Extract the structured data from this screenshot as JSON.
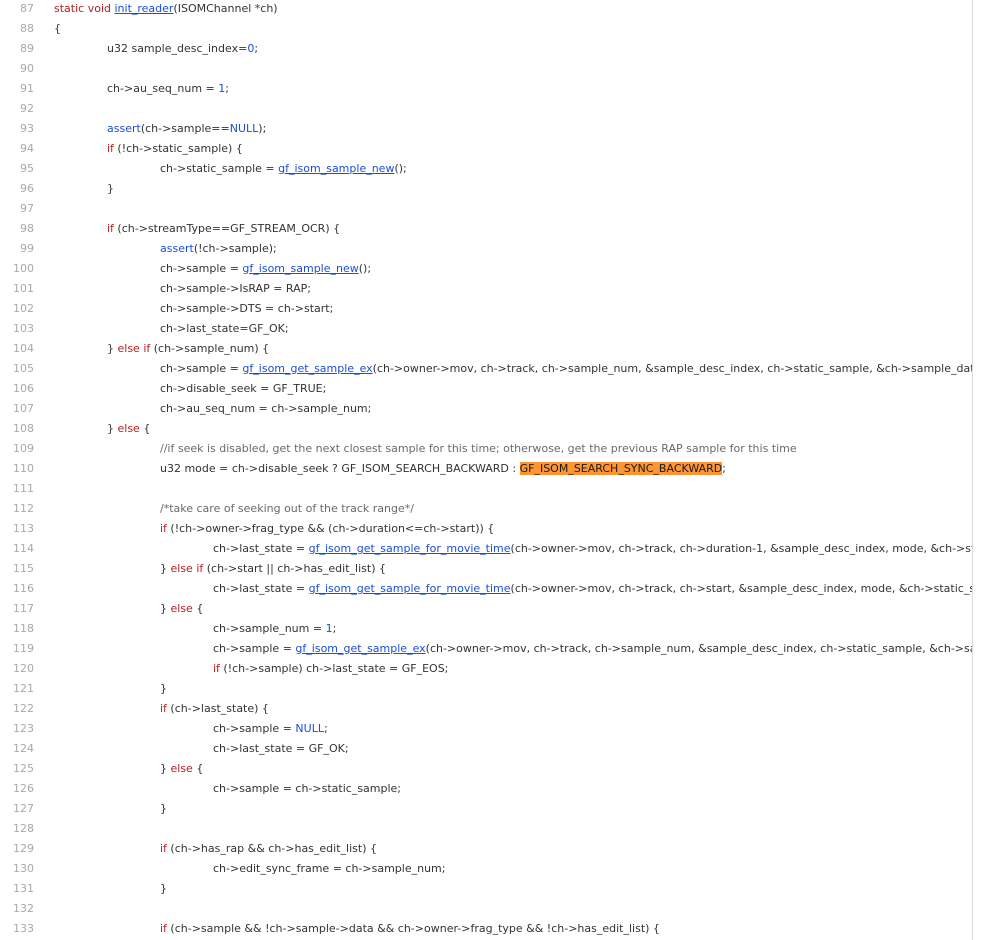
{
  "editor": {
    "lines": [
      {
        "n": "87",
        "indent": 0,
        "parts": [
          {
            "t": "static void ",
            "c": "kw"
          },
          {
            "t": "init_reader",
            "c": "fn"
          },
          {
            "t": "(ISOMChannel *ch)",
            "c": ""
          }
        ]
      },
      {
        "n": "88",
        "indent": 0,
        "parts": [
          {
            "t": "{",
            "c": ""
          }
        ]
      },
      {
        "n": "89",
        "indent": 1,
        "parts": [
          {
            "t": "u32 sample_desc_index=",
            "c": ""
          },
          {
            "t": "0",
            "c": "lit"
          },
          {
            "t": ";",
            "c": ""
          }
        ]
      },
      {
        "n": "90",
        "indent": 0,
        "parts": []
      },
      {
        "n": "91",
        "indent": 1,
        "parts": [
          {
            "t": "ch->au_seq_num = ",
            "c": ""
          },
          {
            "t": "1",
            "c": "lit"
          },
          {
            "t": ";",
            "c": ""
          }
        ]
      },
      {
        "n": "92",
        "indent": 0,
        "parts": []
      },
      {
        "n": "93",
        "indent": 1,
        "parts": [
          {
            "t": "assert",
            "c": "lit"
          },
          {
            "t": "(ch->sample==",
            "c": ""
          },
          {
            "t": "NULL",
            "c": "lit"
          },
          {
            "t": ");",
            "c": ""
          }
        ]
      },
      {
        "n": "94",
        "indent": 1,
        "parts": [
          {
            "t": "if",
            "c": "kw"
          },
          {
            "t": " (!ch->static_sample) {",
            "c": ""
          }
        ]
      },
      {
        "n": "95",
        "indent": 2,
        "parts": [
          {
            "t": "ch->static_sample = ",
            "c": ""
          },
          {
            "t": "gf_isom_sample_new",
            "c": "fn"
          },
          {
            "t": "();",
            "c": ""
          }
        ]
      },
      {
        "n": "96",
        "indent": 1,
        "parts": [
          {
            "t": "}",
            "c": ""
          }
        ]
      },
      {
        "n": "97",
        "indent": 0,
        "parts": []
      },
      {
        "n": "98",
        "indent": 1,
        "parts": [
          {
            "t": "if",
            "c": "kw"
          },
          {
            "t": " (ch->streamType==GF_STREAM_OCR) {",
            "c": ""
          }
        ]
      },
      {
        "n": "99",
        "indent": 2,
        "parts": [
          {
            "t": "assert",
            "c": "lit"
          },
          {
            "t": "(!ch->sample);",
            "c": ""
          }
        ]
      },
      {
        "n": "100",
        "indent": 2,
        "parts": [
          {
            "t": "ch->sample = ",
            "c": ""
          },
          {
            "t": "gf_isom_sample_new",
            "c": "fn"
          },
          {
            "t": "();",
            "c": ""
          }
        ]
      },
      {
        "n": "101",
        "indent": 2,
        "parts": [
          {
            "t": "ch->sample->IsRAP = RAP;",
            "c": ""
          }
        ]
      },
      {
        "n": "102",
        "indent": 2,
        "parts": [
          {
            "t": "ch->sample->DTS = ch->start;",
            "c": ""
          }
        ]
      },
      {
        "n": "103",
        "indent": 2,
        "parts": [
          {
            "t": "ch->last_state=GF_OK;",
            "c": ""
          }
        ]
      },
      {
        "n": "104",
        "indent": 1,
        "parts": [
          {
            "t": "} ",
            "c": ""
          },
          {
            "t": "else if",
            "c": "kw"
          },
          {
            "t": " (ch->sample_num) {",
            "c": ""
          }
        ]
      },
      {
        "n": "105",
        "indent": 2,
        "parts": [
          {
            "t": "ch->sample = ",
            "c": ""
          },
          {
            "t": "gf_isom_get_sample_ex",
            "c": "fn"
          },
          {
            "t": "(ch->owner->mov, ch->track, ch->sample_num, &sample_desc_index, ch->static_sample, &ch->sample_data_offset);",
            "c": ""
          }
        ]
      },
      {
        "n": "106",
        "indent": 2,
        "parts": [
          {
            "t": "ch->disable_seek = GF_TRUE;",
            "c": ""
          }
        ]
      },
      {
        "n": "107",
        "indent": 2,
        "parts": [
          {
            "t": "ch->au_seq_num = ch->sample_num;",
            "c": ""
          }
        ]
      },
      {
        "n": "108",
        "indent": 1,
        "parts": [
          {
            "t": "} ",
            "c": ""
          },
          {
            "t": "else",
            "c": "kw"
          },
          {
            "t": " {",
            "c": ""
          }
        ]
      },
      {
        "n": "109",
        "indent": 2,
        "parts": [
          {
            "t": "//if seek is disabled, get the next closest sample for this time; otherwose, get the previous RAP sample for this time",
            "c": "cm"
          }
        ]
      },
      {
        "n": "110",
        "indent": 2,
        "parts": [
          {
            "t": "u32 mode = ch->disable_seek ? GF_ISOM_SEARCH_BACKWARD : ",
            "c": ""
          },
          {
            "t": "GF_ISOM_SEARCH_SYNC_BACKWARD",
            "c": "hl"
          },
          {
            "t": ";",
            "c": ""
          }
        ]
      },
      {
        "n": "111",
        "indent": 0,
        "parts": []
      },
      {
        "n": "112",
        "indent": 2,
        "parts": [
          {
            "t": "/*take care of seeking out of the track range*/",
            "c": "cm"
          }
        ]
      },
      {
        "n": "113",
        "indent": 2,
        "parts": [
          {
            "t": "if",
            "c": "kw"
          },
          {
            "t": " (!ch->owner->frag_type && (ch->duration<=ch->start)) {",
            "c": ""
          }
        ]
      },
      {
        "n": "114",
        "indent": 3,
        "parts": [
          {
            "t": "ch->last_state = ",
            "c": ""
          },
          {
            "t": "gf_isom_get_sample_for_movie_time",
            "c": "fn"
          },
          {
            "t": "(ch->owner->mov, ch->track, ch->duration-1, &sample_desc_index, mode, &ch->static_sample, &ch->sample_num);",
            "c": ""
          }
        ]
      },
      {
        "n": "115",
        "indent": 2,
        "parts": [
          {
            "t": "} ",
            "c": ""
          },
          {
            "t": "else if",
            "c": "kw"
          },
          {
            "t": " (ch->start || ch->has_edit_list) {",
            "c": ""
          }
        ]
      },
      {
        "n": "116",
        "indent": 3,
        "parts": [
          {
            "t": "ch->last_state = ",
            "c": ""
          },
          {
            "t": "gf_isom_get_sample_for_movie_time",
            "c": "fn"
          },
          {
            "t": "(ch->owner->mov, ch->track, ch->start, &sample_desc_index, mode, &ch->static_sample, &ch->sample_num);",
            "c": ""
          }
        ]
      },
      {
        "n": "117",
        "indent": 2,
        "parts": [
          {
            "t": "} ",
            "c": ""
          },
          {
            "t": "else",
            "c": "kw"
          },
          {
            "t": " {",
            "c": ""
          }
        ]
      },
      {
        "n": "118",
        "indent": 3,
        "parts": [
          {
            "t": "ch->sample_num = ",
            "c": ""
          },
          {
            "t": "1",
            "c": "lit"
          },
          {
            "t": ";",
            "c": ""
          }
        ]
      },
      {
        "n": "119",
        "indent": 3,
        "parts": [
          {
            "t": "ch->sample = ",
            "c": ""
          },
          {
            "t": "gf_isom_get_sample_ex",
            "c": "fn"
          },
          {
            "t": "(ch->owner->mov, ch->track, ch->sample_num, &sample_desc_index, ch->static_sample, &ch->sample_data_offset);",
            "c": ""
          }
        ]
      },
      {
        "n": "120",
        "indent": 3,
        "parts": [
          {
            "t": "if",
            "c": "kw"
          },
          {
            "t": " (!ch->sample) ch->last_state = GF_EOS;",
            "c": ""
          }
        ]
      },
      {
        "n": "121",
        "indent": 2,
        "parts": [
          {
            "t": "}",
            "c": ""
          }
        ]
      },
      {
        "n": "122",
        "indent": 2,
        "parts": [
          {
            "t": "if",
            "c": "kw"
          },
          {
            "t": " (ch->last_state) {",
            "c": ""
          }
        ]
      },
      {
        "n": "123",
        "indent": 3,
        "parts": [
          {
            "t": "ch->sample = ",
            "c": ""
          },
          {
            "t": "NULL",
            "c": "lit"
          },
          {
            "t": ";",
            "c": ""
          }
        ]
      },
      {
        "n": "124",
        "indent": 3,
        "parts": [
          {
            "t": "ch->last_state = GF_OK;",
            "c": ""
          }
        ]
      },
      {
        "n": "125",
        "indent": 2,
        "parts": [
          {
            "t": "} ",
            "c": ""
          },
          {
            "t": "else",
            "c": "kw"
          },
          {
            "t": " {",
            "c": ""
          }
        ]
      },
      {
        "n": "126",
        "indent": 3,
        "parts": [
          {
            "t": "ch->sample = ch->static_sample;",
            "c": ""
          }
        ]
      },
      {
        "n": "127",
        "indent": 2,
        "parts": [
          {
            "t": "}",
            "c": ""
          }
        ]
      },
      {
        "n": "128",
        "indent": 0,
        "parts": []
      },
      {
        "n": "129",
        "indent": 2,
        "parts": [
          {
            "t": "if",
            "c": "kw"
          },
          {
            "t": " (ch->has_rap && ch->has_edit_list) {",
            "c": ""
          }
        ]
      },
      {
        "n": "130",
        "indent": 3,
        "parts": [
          {
            "t": "ch->edit_sync_frame = ch->sample_num;",
            "c": ""
          }
        ]
      },
      {
        "n": "131",
        "indent": 2,
        "parts": [
          {
            "t": "}",
            "c": ""
          }
        ]
      },
      {
        "n": "132",
        "indent": 0,
        "parts": []
      },
      {
        "n": "133",
        "indent": 2,
        "parts": [
          {
            "t": "if",
            "c": "kw"
          },
          {
            "t": " (ch->sample && !ch->sample->data && ch->owner->frag_type && !ch->has_edit_list) {",
            "c": ""
          }
        ]
      }
    ]
  }
}
